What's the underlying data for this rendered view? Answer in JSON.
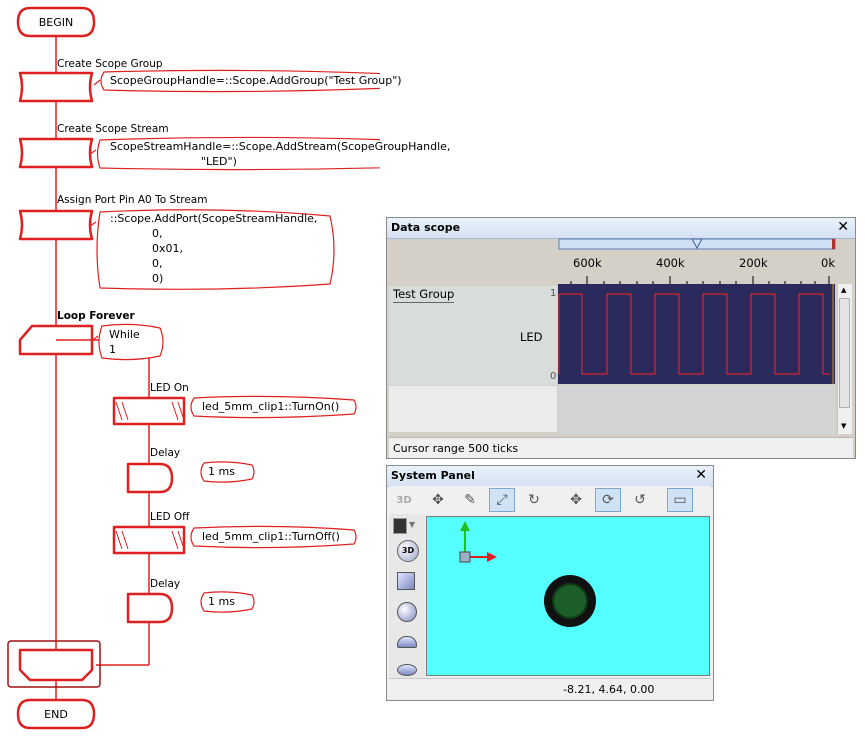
{
  "flowchart": {
    "begin_label": "BEGIN",
    "end_label": "END",
    "steps": [
      {
        "label": "Create Scope Group",
        "code": "ScopeGroupHandle=::Scope.AddGroup(\"Test Group\")"
      },
      {
        "label": "Create Scope Stream",
        "code": "ScopeStreamHandle=::Scope.AddStream(ScopeGroupHandle,\n                          \"LED\")"
      },
      {
        "label": "Assign Port Pin A0 To Stream",
        "code": "::Scope.AddPort(ScopeStreamHandle,\n            0,\n            0x01,\n            0,\n            0)"
      }
    ],
    "loop": {
      "label": "Loop Forever",
      "code": "While\n1"
    },
    "inner": [
      {
        "label": "LED On",
        "code": "led_5mm_clip1::TurnOn()"
      },
      {
        "label": "Delay",
        "code": "1 ms"
      },
      {
        "label": "LED Off",
        "code": "led_5mm_clip1::TurnOff()"
      },
      {
        "label": "Delay",
        "code": "1 ms"
      }
    ],
    "outline_color": "#e02020"
  },
  "data_scope": {
    "title": "Data scope",
    "axis_ticks": [
      "600k",
      "400k",
      "200k",
      "0k"
    ],
    "group_name": "Test Group",
    "stream_name": "LED",
    "y_top": "1",
    "y_bottom": "0",
    "status": "Cursor range 500 ticks",
    "plot_bg": "#2a2a5c",
    "trace_color": "#ff2020"
  },
  "system_panel": {
    "title": "System Panel",
    "toolbar_3d_label": "3D",
    "side_3d_label": "3D",
    "status": "-8.21, 4.64, 0.00",
    "view_bg": "#55ffff"
  }
}
